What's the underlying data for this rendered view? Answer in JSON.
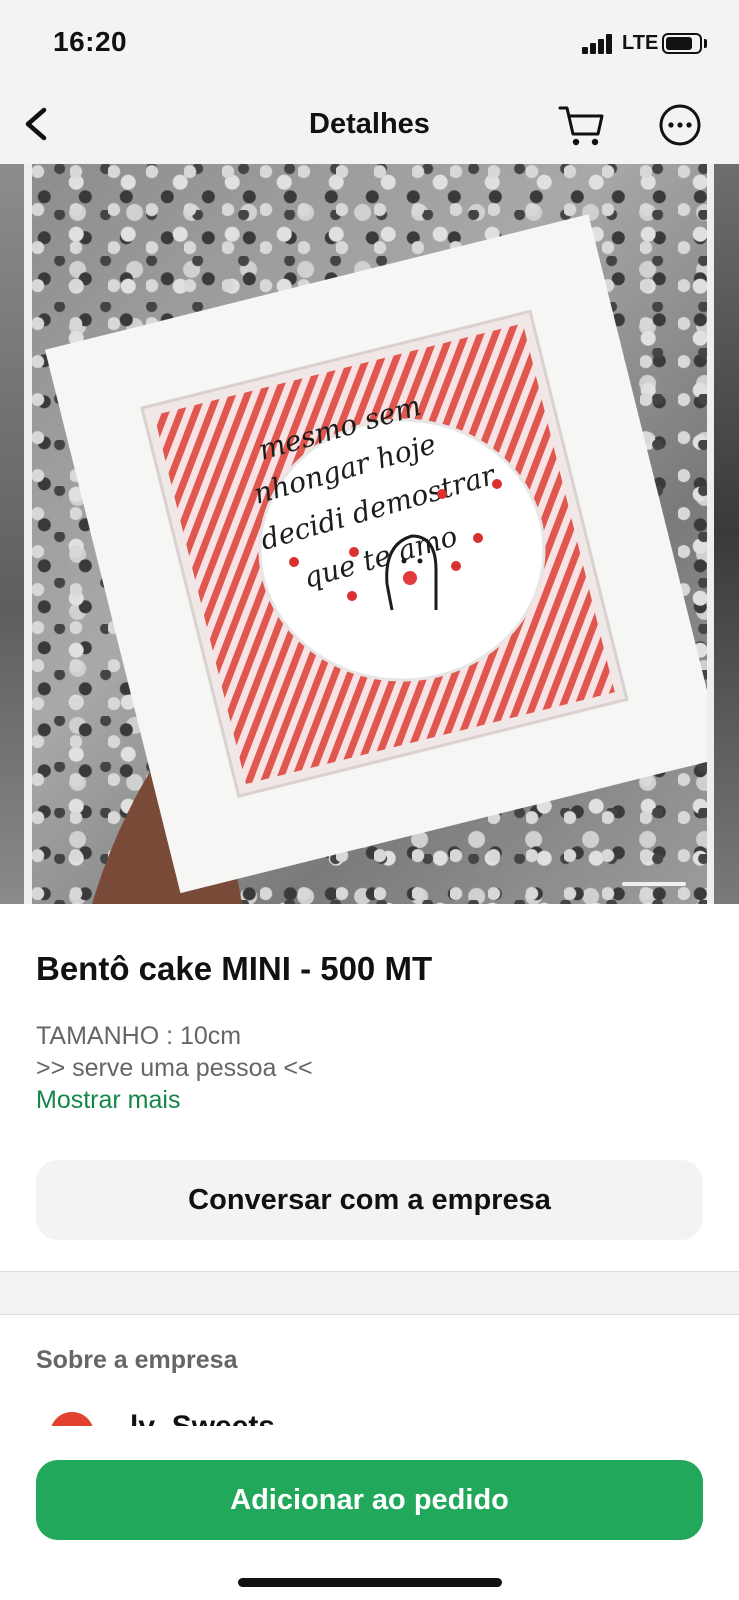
{
  "status_bar": {
    "time": "16:20",
    "network": "LTE",
    "icons": [
      "signal-icon",
      "battery-icon"
    ]
  },
  "nav": {
    "title": "Detalhes",
    "icons": [
      "back-arrow-icon",
      "cart-icon",
      "more-options-icon"
    ]
  },
  "carousel": {
    "cake_text_lines": [
      "mesmo sem",
      "nhongar hoje",
      "decidi demostrar",
      "que te amo"
    ]
  },
  "product": {
    "title": "Bentô cake MINI - 500 MT",
    "description_lines": [
      "TAMANHO : 10cm",
      ">> serve uma pessoa <<"
    ],
    "show_more_label": "Mostrar mais"
  },
  "chat_button_label": "Conversar com a empresa",
  "about": {
    "heading": "Sobre a empresa",
    "company_name": "lv_Sweets"
  },
  "add_to_order_label": "Adicionar ao pedido",
  "colors": {
    "accent_green": "#21a85a",
    "link_green": "#15864a",
    "background_gray": "#f3f3f3"
  }
}
